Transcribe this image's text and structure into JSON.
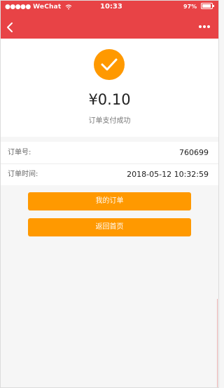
{
  "status_bar": {
    "signal": "●●●●●",
    "carrier": "WeChat",
    "wifi_icon": "wifi-icon",
    "time": "10:33",
    "battery": "97%"
  },
  "header": {
    "back_icon": "chevron-left-icon",
    "more_icon": "more-dots-icon",
    "background_color": "#e84346"
  },
  "payment": {
    "success_icon": "checkmark-icon",
    "accent_color": "#ff9900",
    "amount": "¥0.10",
    "status_text": "订单支付成功"
  },
  "order_info": {
    "order_no_label": "订单号:",
    "order_no_value": "760699",
    "order_time_label": "订单时间:",
    "order_time_value": "2018-05-12 10:32:59"
  },
  "actions": {
    "my_orders_label": "我的订单",
    "back_home_label": "返回首页"
  }
}
